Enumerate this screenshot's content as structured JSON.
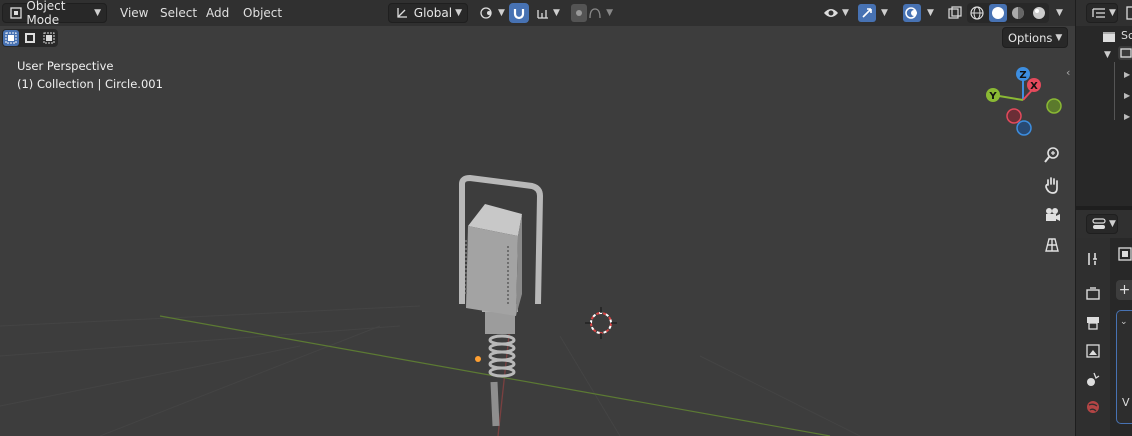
{
  "header": {
    "mode_label": "Object Mode",
    "menus": [
      "View",
      "Select",
      "Add",
      "Object"
    ],
    "orientation_label": "Global"
  },
  "viewport": {
    "overlay_line1": "User Perspective",
    "overlay_line2": "(1) Collection | Circle.001",
    "options_label": "Options",
    "gizmo_axes": {
      "z": "Z",
      "x": "X",
      "y": "Y"
    }
  },
  "outliner": {
    "label_partial": "Sc"
  },
  "properties": {
    "partial_text": "V"
  },
  "colors": {
    "axis_x": "#e44a5c",
    "axis_y": "#8ab934",
    "axis_z": "#3d8ee0",
    "accent_blue": "#4772b3",
    "origin_dot": "#ffa032"
  },
  "icons": [
    "editor-type-icon",
    "select-box-icon",
    "transform-orientation-icon",
    "pivot-icon",
    "snap-icon",
    "proportional-editing-icon",
    "visibility-icon",
    "gizmo-icon",
    "overlay-icon",
    "xray-icon",
    "shading-wire-icon",
    "shading-solid-icon",
    "shading-material-icon",
    "shading-rendered-icon",
    "zoom-icon",
    "pan-hand-icon",
    "camera-icon",
    "grid-view-icon",
    "tool-icon",
    "render-icon",
    "output-icon",
    "view-layer-icon",
    "scene-icon",
    "world-icon"
  ]
}
